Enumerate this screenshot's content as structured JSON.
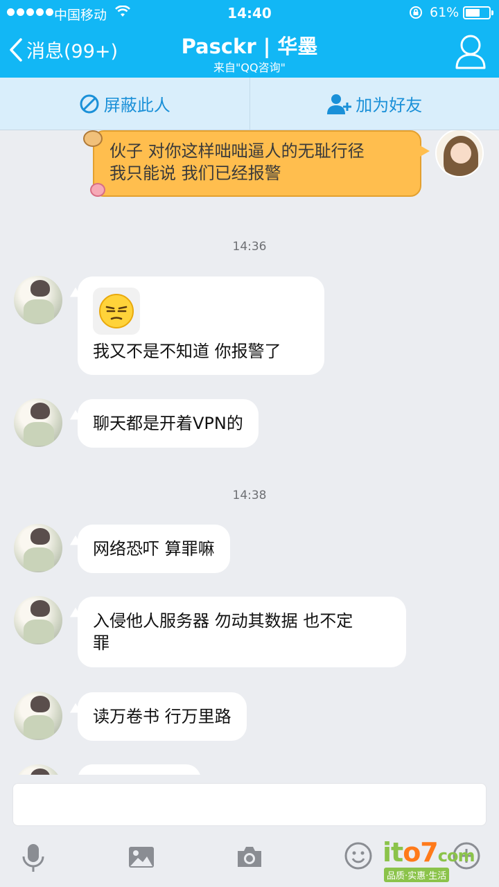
{
  "status_bar": {
    "carrier": "中国移动",
    "time": "14:40",
    "battery_percent": "61%",
    "battery_level": 0.61
  },
  "header": {
    "back_label": "消息(99+)",
    "title": "Pasckr | 华墨",
    "subtitle": "来自\"QQ咨询\""
  },
  "actions": {
    "block_label": "屏蔽此人",
    "add_friend_label": "加为好友"
  },
  "messages": [
    {
      "side": "right",
      "text": [
        "伙子 对你这样咄咄逼人的无耻行径",
        "我只能说 我们已经报警"
      ]
    },
    {
      "type": "time",
      "text": "14:36"
    },
    {
      "side": "left",
      "emoji": "annoyed-face-icon",
      "text": [
        "我又不是不知道 你报警了"
      ]
    },
    {
      "side": "left",
      "text": [
        "聊天都是开着VPN的"
      ]
    },
    {
      "type": "time",
      "text": "14:38"
    },
    {
      "side": "left",
      "text": [
        "网络恐吓 算罪嘛"
      ]
    },
    {
      "side": "left",
      "text": [
        "入侵他人服务器 勿动其数据 也不定",
        "罪"
      ]
    },
    {
      "side": "left",
      "text": [
        "读万卷书 行万里路"
      ]
    }
  ],
  "toolbar": {
    "icons": [
      "microphone-icon",
      "image-icon",
      "camera-icon",
      "emoji-icon",
      "plus-icon"
    ]
  },
  "watermark": {
    "text_a": "it",
    "text_b": "o7",
    "text_c": "com",
    "tagline": "品质·实惠·生活"
  },
  "colors": {
    "header_bg": "#12b7f5",
    "action_bar_bg": "#d9eefb",
    "chat_bg": "#ebedf1",
    "own_bubble": "#ffbe4e",
    "action_text": "#1a90d8"
  }
}
